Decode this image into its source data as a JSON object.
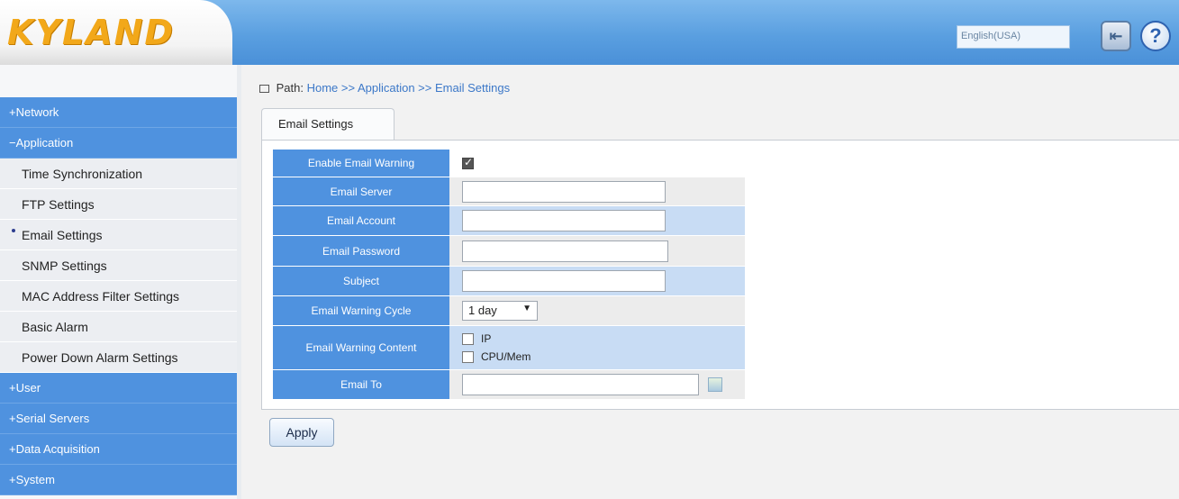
{
  "header": {
    "logo": "KYLAND",
    "language": "English(USA)",
    "logout_icon": "logout-icon",
    "help_icon": "help-icon"
  },
  "sidebar": {
    "items": [
      {
        "label": "+Network",
        "type": "group"
      },
      {
        "label": "−Application",
        "type": "group"
      },
      {
        "label": "Time Synchronization",
        "type": "sub"
      },
      {
        "label": "FTP Settings",
        "type": "sub"
      },
      {
        "label": "Email Settings",
        "type": "sub",
        "active": true
      },
      {
        "label": "SNMP Settings",
        "type": "sub"
      },
      {
        "label": "MAC Address Filter Settings",
        "type": "sub"
      },
      {
        "label": "Basic Alarm",
        "type": "sub"
      },
      {
        "label": "Power Down Alarm Settings",
        "type": "sub"
      },
      {
        "label": "+User",
        "type": "group"
      },
      {
        "label": "+Serial Servers",
        "type": "group"
      },
      {
        "label": "+Data Acquisition",
        "type": "group"
      },
      {
        "label": "+System",
        "type": "group"
      }
    ]
  },
  "path": {
    "prefix": "Path:",
    "crumbs": "Home >> Application >> Email Settings"
  },
  "tab": {
    "label": "Email Settings"
  },
  "form": {
    "enable_warning": {
      "label": "Enable Email Warning",
      "checked": true
    },
    "server": {
      "label": "Email Server",
      "value": ""
    },
    "account": {
      "label": "Email Account",
      "value": ""
    },
    "password": {
      "label": "Email Password",
      "value": ""
    },
    "subject": {
      "label": "Subject",
      "value": ""
    },
    "cycle": {
      "label": "Email Warning Cycle",
      "value": "1 day"
    },
    "content": {
      "label": "Email Warning Content",
      "options": [
        {
          "label": "IP",
          "checked": false
        },
        {
          "label": "CPU/Mem",
          "checked": false
        }
      ]
    },
    "email_to": {
      "label": "Email To",
      "value": ""
    }
  },
  "actions": {
    "apply": "Apply"
  },
  "colors": {
    "accent": "#4f92df",
    "header": "#5a9fe0",
    "logo": "#f2a81a"
  }
}
